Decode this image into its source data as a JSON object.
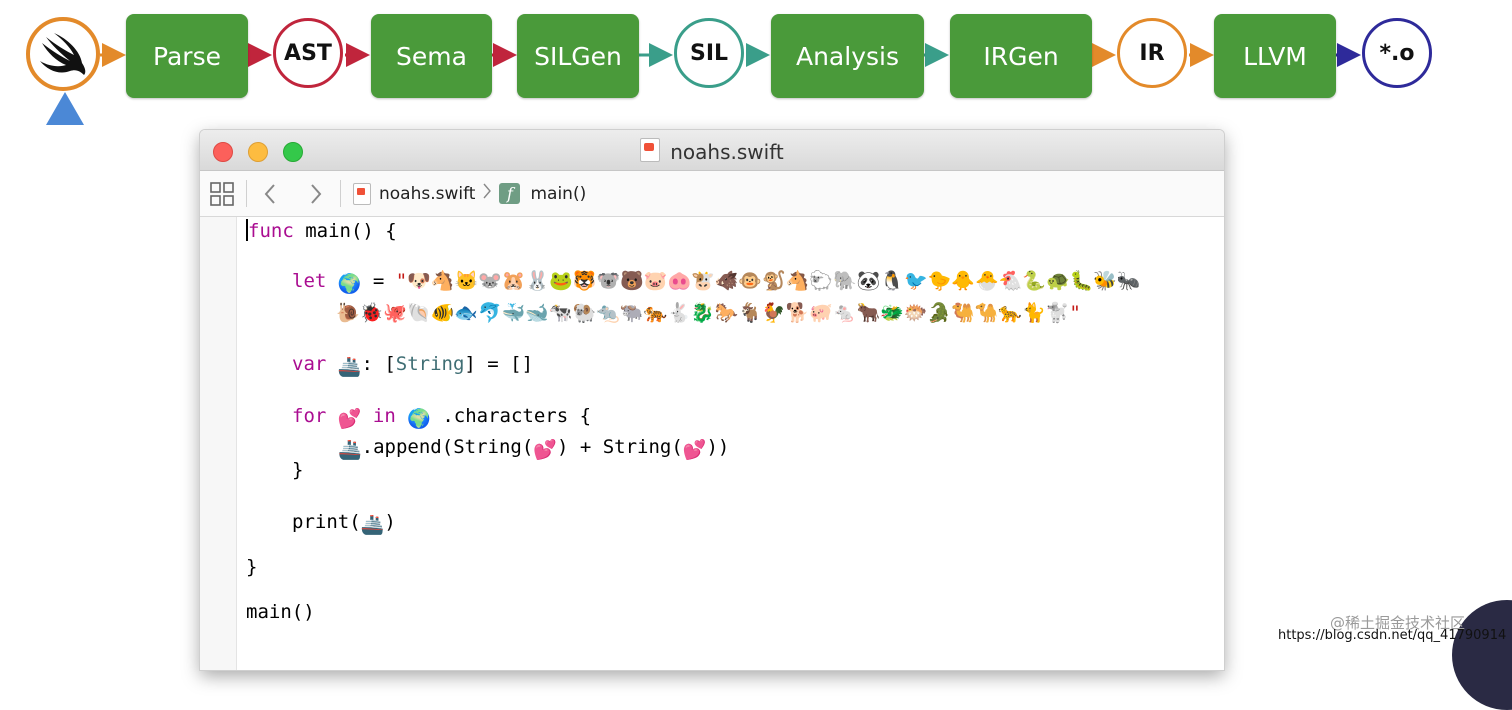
{
  "pipeline": {
    "stages": [
      {
        "label": "Parse"
      },
      {
        "label": "AST"
      },
      {
        "label": "Sema"
      },
      {
        "label": "SILGen"
      },
      {
        "label": "SIL"
      },
      {
        "label": "Analysis"
      },
      {
        "label": "IRGen"
      },
      {
        "label": "IR"
      },
      {
        "label": "LLVM"
      },
      {
        "label": "*.o"
      }
    ],
    "colors": {
      "box_green": "#4a9a3a",
      "orange": "#e38a2a",
      "red": "#c0253c",
      "teal": "#3a9e8a",
      "navy": "#2e2a9a",
      "marker_blue": "#4b88d6"
    },
    "icons": [
      "swift-logo-icon",
      "current-stage-marker-icon"
    ]
  },
  "window": {
    "title": "noahs.swift",
    "jumpbar": {
      "file": "noahs.swift",
      "symbol_badge": "f",
      "symbol": "main()"
    },
    "icons": [
      "grid-icon",
      "back-arrow-icon",
      "forward-arrow-icon",
      "swift-file-icon",
      "function-icon"
    ]
  },
  "code": {
    "func_kw": "func",
    "func_sig": " main() {",
    "let_kw": "let",
    "earth": "🌍",
    "eq": " = ",
    "animals_line1": "\"🐶🐴🐱🐭🐹🐰🐸🐯🐨🐻🐷🐽🐮🐗🐵🐒🐴🐑🐘🐼🐧🐦🐤🐥🐣🐔🐍🐢🐛🐝🐜",
    "animals_line2": "🐌🐞🐙🐚🐠🐟🐬🐳🐋🐄🐏🐀🐃🐅🐇🐉🐎🐐🐓🐕🐖🐁🐂🐲🐡🐊🐫🐪🐆🐈🐩\"",
    "var_kw": "var",
    "boat": "🚢",
    "var_colon": ": [",
    "string_type": "String",
    "var_rest": "] = []",
    "for_kw": "for",
    "hearts": "💕",
    "in_kw": "in",
    "characters": " .characters {",
    "append_pre": ".append(",
    "string_call": "String(",
    "append_mid": ") + ",
    "append_end": "))",
    "close_brace": "}",
    "print_pre": "print(",
    "paren_close": ")",
    "main_call": "main()"
  },
  "watermark": {
    "line1": "@稀土掘金技术社区",
    "line2": "https://blog.csdn.net/qq_41790914"
  }
}
